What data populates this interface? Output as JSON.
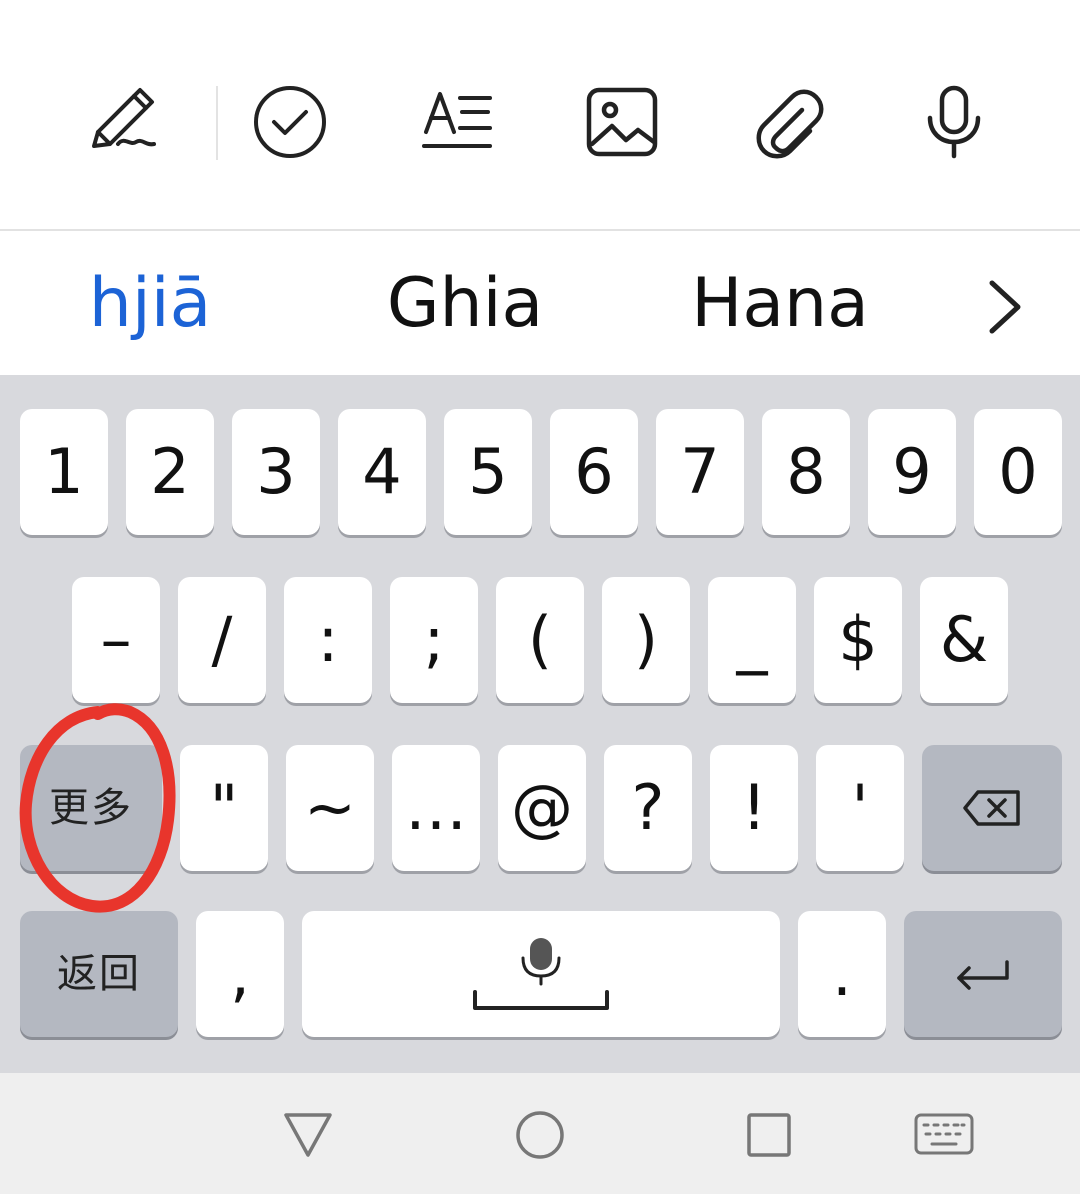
{
  "toolbar": {
    "icons": [
      "handwriting-pen-icon",
      "checkmark-circle-icon",
      "text-format-icon",
      "image-icon",
      "attachment-icon",
      "microphone-icon"
    ]
  },
  "suggestions": {
    "items": [
      "hjiā",
      "Ghia",
      "Hana"
    ],
    "primary_color": "#1c63d6",
    "expand_icon": "chevron-right-icon"
  },
  "keyboard": {
    "row1": [
      "1",
      "2",
      "3",
      "4",
      "5",
      "6",
      "7",
      "8",
      "9",
      "0"
    ],
    "row2": [
      "–",
      "/",
      ":",
      ";",
      "(",
      ")",
      "_",
      "$",
      "&"
    ],
    "row3": [
      "\"",
      "~",
      "…",
      "@",
      "?",
      "!",
      "'"
    ],
    "more_label": "更多",
    "back_label": "返回",
    "comma": ",",
    "period": ".",
    "backspace_icon": "backspace-icon",
    "enter_icon": "enter-icon",
    "space_icon": "space-mic-icon",
    "key_color": "#ffffff",
    "fn_key_color": "#b4b8c1",
    "background": "#d8d9dd"
  },
  "annotation": {
    "color": "#e8352c",
    "target": "更多"
  },
  "navbar": {
    "icons": [
      "back-triangle-icon",
      "home-circle-icon",
      "recents-square-icon",
      "keyboard-switch-icon"
    ]
  }
}
